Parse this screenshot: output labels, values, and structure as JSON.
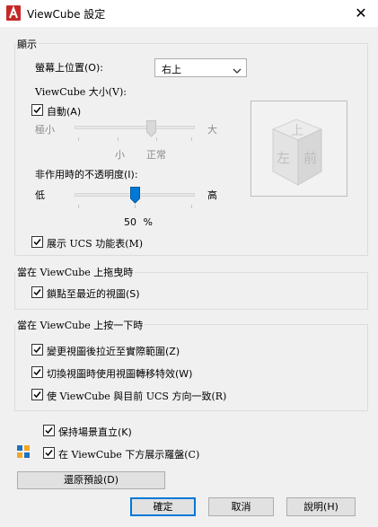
{
  "window": {
    "title": "ViewCube 設定",
    "close_glyph": "✕"
  },
  "display": {
    "group_label": "顯示",
    "screen_position_label": "螢幕上位置(O):",
    "screen_position_value": "右上",
    "size_label": "ViewCube 大小(V):",
    "auto_label": "自動(A)",
    "auto_checked": true,
    "size_min_label": "極小",
    "size_max_label": "大",
    "size_small_label": "小",
    "size_normal_label": "正常",
    "opacity_label": "非作用時的不透明度(I):",
    "opacity_low_label": "低",
    "opacity_high_label": "高",
    "opacity_value": "50",
    "opacity_unit": "%",
    "ucs_menu_label": "展示 UCS 功能表(M)",
    "ucs_menu_checked": true
  },
  "cube_preview": {
    "top_face": "上",
    "left_face": "左",
    "front_face": "前"
  },
  "dragging": {
    "group_label": "當在 ViewCube 上拖曳時",
    "snap_label": "鎖點至最近的視圖(S)",
    "snap_checked": true
  },
  "clicking": {
    "group_label": "當在 ViewCube 上按一下時",
    "zoom_label": "變更視圖後拉近至實際範圍(Z)",
    "zoom_checked": true,
    "transition_label": "切換視圖時使用視圖轉移特效(W)",
    "transition_checked": true,
    "orient_label": "使 ViewCube 與目前 UCS 方向一致(R)",
    "orient_checked": true
  },
  "bottom": {
    "keep_upright_label": "保持場景直立(K)",
    "keep_upright_checked": true,
    "compass_label": "在 ViewCube 下方展示羅盤(C)",
    "compass_checked": true,
    "restore_defaults_label": "還原預設(D)",
    "ok_label": "確定",
    "cancel_label": "取消",
    "help_label": "說明(H)"
  },
  "colors": {
    "accent": "#0078d7",
    "app_icon_red": "#c62828"
  }
}
